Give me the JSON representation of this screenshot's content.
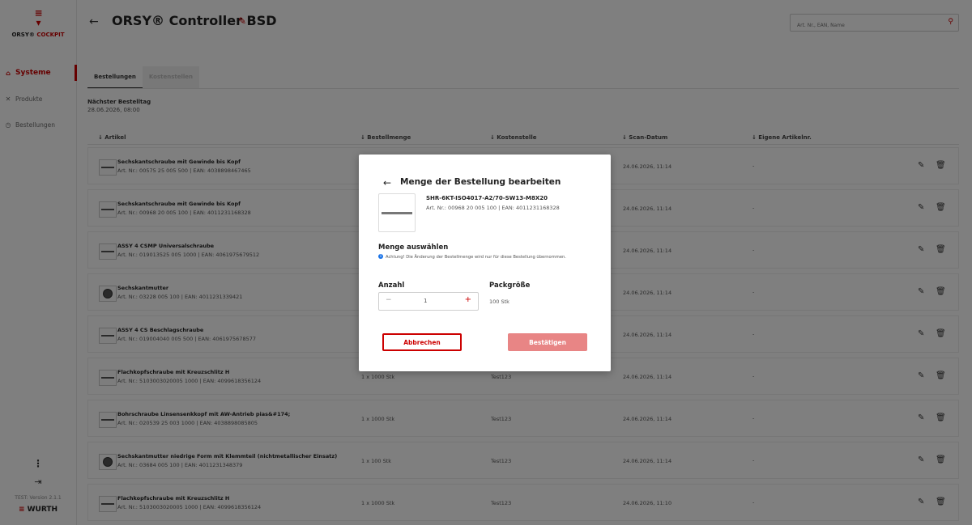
{
  "brand": {
    "name_black": "ORSY® ",
    "name_red": "COCKPIT"
  },
  "sidebar": {
    "items": [
      {
        "label": "Systeme",
        "icon": "home-icon",
        "glyph": "⌂"
      },
      {
        "label": "Produkte",
        "icon": "tools-icon",
        "glyph": "✕"
      },
      {
        "label": "Bestellungen",
        "icon": "history-icon",
        "glyph": "◷"
      }
    ],
    "more_glyph": "⋮",
    "logout_glyph": "⇥",
    "version": "TEST: Version 2.1.1",
    "wurth": "WURTH"
  },
  "header": {
    "back": "←",
    "title": "ORSY® Controller BSD",
    "edit": "✎",
    "search_placeholder": "Art. Nr., EAN, Name",
    "search_icon": "⚲"
  },
  "tabs": [
    {
      "label": "Bestellungen"
    },
    {
      "label": "Kostenstellen"
    }
  ],
  "next_order": {
    "label": "Nächster Bestelltag",
    "value": "28.06.2026, 08:00"
  },
  "table": {
    "headers": [
      "↓ Artikel",
      "↓ Bestellmenge",
      "↓ Kostenstelle",
      "↓ Scan-Datum",
      "↓ Eigene Artikelnr."
    ],
    "rows": [
      {
        "name": "Sechskantschraube mit Gewinde bis Kopf",
        "sub": "Art. Nr.: 00575 25 005 500 | EAN: 4038898467465",
        "qty": "",
        "cost": "",
        "date": "24.06.2026, 11:14",
        "own": "-"
      },
      {
        "name": "Sechskantschraube mit Gewinde bis Kopf",
        "sub": "Art. Nr.: 00968 20 005 100 | EAN: 4011231168328",
        "qty": "",
        "cost": "",
        "date": "24.06.2026, 11:14",
        "own": "-"
      },
      {
        "name": "ASSY 4 CSMP Universalschraube",
        "sub": "Art. Nr.: 019013525 005 1000 | EAN: 4061975679512",
        "qty": "",
        "cost": "",
        "date": "24.06.2026, 11:14",
        "own": "-"
      },
      {
        "name": "Sechskantmutter",
        "sub": "Art. Nr.: 03228  005 100 | EAN: 4011231339421",
        "qty": "",
        "cost": "",
        "date": "24.06.2026, 11:14",
        "own": "-"
      },
      {
        "name": "ASSY 4 CS Beschlagschraube",
        "sub": "Art. Nr.: 019004040 005 500 | EAN: 4061975678577",
        "qty": "",
        "cost": "",
        "date": "24.06.2026, 11:14",
        "own": "-"
      },
      {
        "name": "Flachkopfschraube mit Kreuzschlitz H",
        "sub": "Art. Nr.: 5103003020005 1000 | EAN: 4099618356124",
        "qty": "1 x 1000 Stk",
        "cost": "Test123",
        "date": "24.06.2026, 11:14",
        "own": "-"
      },
      {
        "name": "Bohrschraube Linsensenkkopf mit AW-Antrieb pias&#174;",
        "sub": "Art. Nr.: 020539 25 003 1000 | EAN: 4038898085805",
        "qty": "1 x 1000 Stk",
        "cost": "Test123",
        "date": "24.06.2026, 11:14",
        "own": "-"
      },
      {
        "name": "Sechskantmutter niedrige Form mit Klemmteil (nichtmetallischer Einsatz)",
        "sub": "Art. Nr.: 03684  005 100 | EAN: 4011231348379",
        "qty": "1 x 100 Stk",
        "cost": "Test123",
        "date": "24.06.2026, 11:14",
        "own": "-"
      },
      {
        "name": "Flachkopfschraube mit Kreuzschlitz H",
        "sub": "Art. Nr.: 5103003020005 1000 | EAN: 4099618356124",
        "qty": "1 x 1000 Stk",
        "cost": "Test123",
        "date": "24.06.2026, 11:10",
        "own": "-"
      }
    ],
    "edit_glyph": "✎",
    "delete_glyph": "🗑"
  },
  "modal": {
    "back": "←",
    "title": "Menge der Bestellung bearbeiten",
    "product_code": "SHR-6KT-ISO4017-A2/70-SW13-M8X20",
    "product_sub": "Art. Nr.: 00968 20 005 100 | EAN: 4011231168328",
    "select_label": "Menge auswählen",
    "info_glyph": "i",
    "info_text": "Achtung! Die Änderung der Bestellmenge wird nur für diese Bestellung übernommen.",
    "amount_label": "Anzahl",
    "pack_label": "Packgröße",
    "minus": "−",
    "value": "1",
    "plus": "+",
    "pack_value": "100 Stk",
    "cancel": "Abbrechen",
    "confirm": "Bestätigen"
  },
  "colors": {
    "accent": "#cc0000",
    "confirm_disabled": "#e88585",
    "info": "#1a73e8"
  }
}
